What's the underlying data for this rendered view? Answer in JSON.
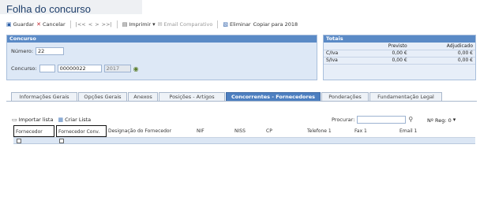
{
  "window": {
    "title": "Folha do concurso"
  },
  "toolbar": {
    "guardar": "Guardar",
    "cancelar": "Cancelar",
    "nav": [
      "|<<",
      "<",
      ">",
      ">>|"
    ],
    "imprimir": "Imprimir",
    "email": "Email Comparativo",
    "eliminar": "Eliminar",
    "copiar": "Copiar para 2018"
  },
  "concurso": {
    "header": "Concurso",
    "numero_label": "Número:",
    "numero_value": "22",
    "concurso_label": "Concurso:",
    "concurso_code": "",
    "concurso_number": "00000022",
    "concurso_year": "2017"
  },
  "totais": {
    "header": "Totais",
    "columns": [
      "",
      "Previsto",
      "Adjudicado"
    ],
    "rows": [
      {
        "label": "C/Iva",
        "previsto": "0,00 €",
        "adjudicado": "0,00 €"
      },
      {
        "label": "S/Iva",
        "previsto": "0,00 €",
        "adjudicado": "0,00 €"
      }
    ]
  },
  "tabs": [
    "Informações Gerais",
    "Opções Gerais",
    "Anexos",
    "Posições - Artigos",
    "Concorrentes - Fornecedores",
    "Ponderações",
    "Fundamentação Legal"
  ],
  "active_tab": 4,
  "subbar": {
    "importar": "Importar lista",
    "criar": "Criar Lista",
    "procurar": "Procurar:",
    "search_value": "",
    "reg_label": "Nº Reg: 0"
  },
  "grid": {
    "columns": [
      "Fornecedor",
      "Fornecedor Conv.",
      "Designação do Fornecedor",
      "NIF",
      "NISS",
      "CP",
      "Telefone 1",
      "Fax 1",
      "Email 1"
    ]
  },
  "colors": {
    "panel_head": "#5a8ac6",
    "active_tab": "#4d7fc0",
    "title": "#1f3f6b"
  }
}
